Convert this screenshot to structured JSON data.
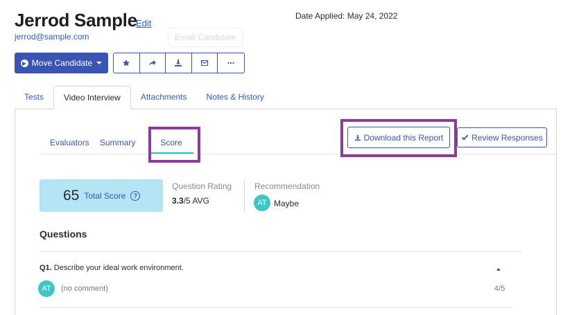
{
  "candidate": {
    "name": "Jerrod Sample",
    "edit_label": "Edit",
    "email": "jerrod@sample.com",
    "date_applied": "Date Applied: May 24, 2022",
    "email_candidate_label": "Email Candidate"
  },
  "actions": {
    "move_label": "Move Candidate",
    "icons": [
      "star-icon",
      "share-icon",
      "download-icon",
      "envelope-icon",
      "ellipsis-icon"
    ]
  },
  "tabs": [
    {
      "label": "Tests",
      "active": false
    },
    {
      "label": "Video Interview",
      "active": true
    },
    {
      "label": "Attachments",
      "active": false
    },
    {
      "label": "Notes & History",
      "active": false
    }
  ],
  "subtabs": [
    {
      "label": "Evaluators",
      "active": false
    },
    {
      "label": "Summary",
      "active": false
    },
    {
      "label": "Score",
      "active": true
    }
  ],
  "buttons": {
    "download_report": "Download this Report",
    "review_responses": "Review Responses"
  },
  "score": {
    "value": "65",
    "label": "Total Score",
    "question_rating_label": "Question Rating",
    "question_rating_value": "3.3",
    "question_rating_suffix": "/5 AVG",
    "recommendation_label": "Recommendation",
    "recommendation_initials": "AT",
    "recommendation_value": "Maybe"
  },
  "questions": {
    "title": "Questions",
    "items": [
      {
        "number": "Q1.",
        "text": "Describe your ideal work environment.",
        "reviewer_initials": "AT",
        "comment": "(no comment)",
        "score": "4/5"
      }
    ]
  },
  "colors": {
    "primary": "#3a54b4",
    "link": "#2c5ec8",
    "score_bg": "#b3e5f4",
    "avatar": "#3ac7c5",
    "highlight": "#8b3a9e",
    "active_underline": "#28c1c7"
  }
}
